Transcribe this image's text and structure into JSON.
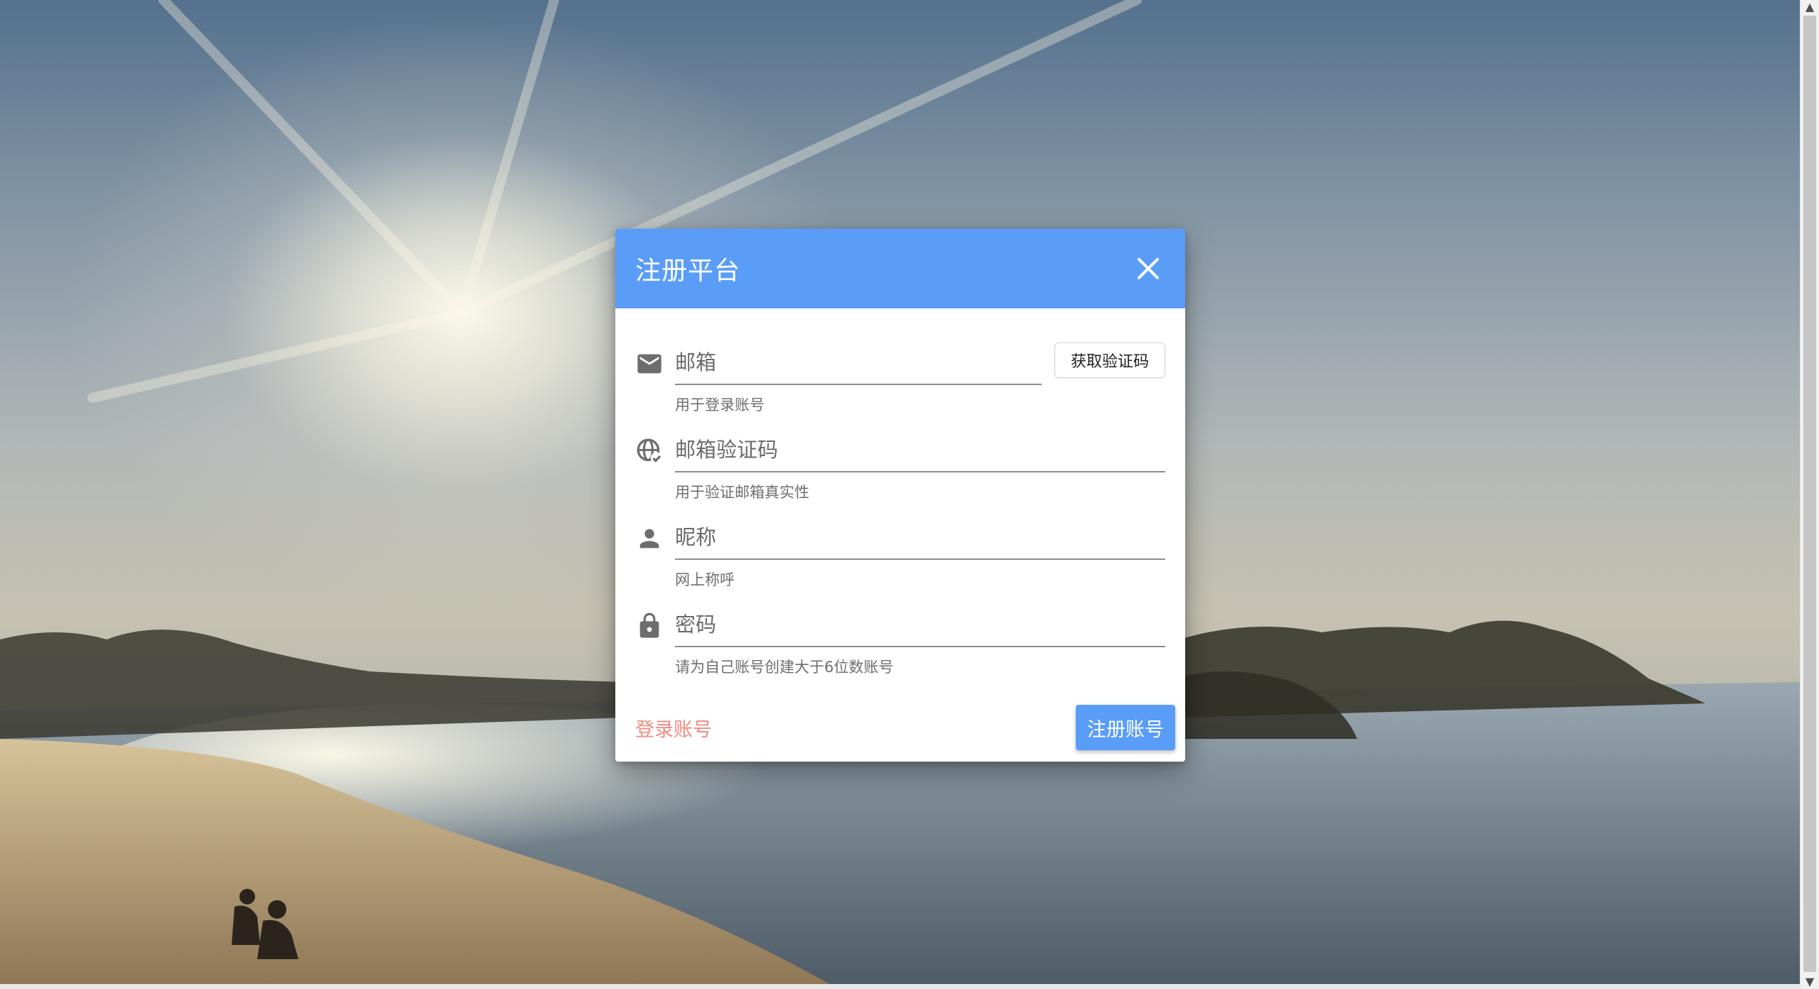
{
  "dialog": {
    "title": "注册平台",
    "close_icon": "close-icon"
  },
  "fields": {
    "email": {
      "icon": "mail-icon",
      "placeholder": "邮箱",
      "hint": "用于登录账号",
      "code_button": "获取验证码"
    },
    "code": {
      "icon": "globe-check-icon",
      "placeholder": "邮箱验证码",
      "hint": "用于验证邮箱真实性"
    },
    "nickname": {
      "icon": "person-icon",
      "placeholder": "昵称",
      "hint": "网上称呼"
    },
    "password": {
      "icon": "lock-icon",
      "placeholder": "密码",
      "hint": "请为自己账号创建大于6位数账号"
    }
  },
  "footer": {
    "login_link": "登录账号",
    "register_button": "注册账号"
  },
  "colors": {
    "primary": "#5a9df8",
    "link": "#f08a80"
  }
}
